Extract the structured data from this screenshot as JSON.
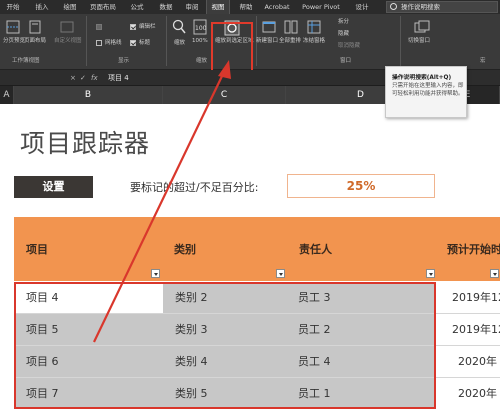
{
  "menu": {
    "tabs": [
      "开始",
      "插入",
      "绘图",
      "页面布局",
      "公式",
      "数据",
      "审阅",
      "视图",
      "帮助",
      "Acrobat",
      "Power Pivot",
      "设计"
    ],
    "active_tab": "视图",
    "search_label": "操作说明搜索"
  },
  "ribbon": {
    "workbook_views": {
      "normal_label": "分页预览",
      "page_layout_label": "页面布局",
      "custom_label": "自定义视图",
      "group_label": "工作簿视图"
    },
    "show": {
      "ruler_label": "编辑栏",
      "gridlines_label": "网格线",
      "headings_label": "标题",
      "group_label": "显示"
    },
    "zoom": {
      "zoom_label": "缩放",
      "hundred_label": "100%",
      "zoom_selection_label": "缩放到选定区域",
      "group_label": "缩放"
    },
    "window": {
      "new_window_label": "新建窗口",
      "arrange_all_label": "全部重排",
      "freeze_label": "冻结窗格",
      "split_label": "拆分",
      "hide_label": "隐藏",
      "unhide_label": "取消隐藏",
      "group_label": "窗口"
    },
    "switch": {
      "switch_windows_label": "切换窗口",
      "group_label": "宏"
    }
  },
  "tooltip": {
    "title": "操作说明搜索(Alt+Q)",
    "body": "只需开始在这里输入内容，即可轻松利用功能并获得帮助。"
  },
  "formula_bar": {
    "name_box": "",
    "cancel": "×",
    "enter": "✓",
    "fx": "fx",
    "content": "项目 4"
  },
  "columns": [
    "A",
    "B",
    "C",
    "D",
    "E"
  ],
  "selected_columns": [
    "B",
    "C",
    "D"
  ],
  "sheet": {
    "title": "项目跟踪器",
    "setup_button": "设置",
    "percent_label": "要标记的超过/不足百分比:",
    "percent_value": "25%"
  },
  "table": {
    "headers": [
      "项目",
      "类别",
      "责任人",
      "预计开始时"
    ],
    "rows": [
      [
        "项目 4",
        "类别 2",
        "员工 3",
        "2019年12"
      ],
      [
        "项目 5",
        "类别 3",
        "员工 2",
        "2019年12"
      ],
      [
        "项目 6",
        "类别 4",
        "员工 4",
        "2020年"
      ],
      [
        "项目 7",
        "类别 5",
        "员工 1",
        "2020年"
      ]
    ]
  },
  "colors": {
    "header_orange": "#f2944f",
    "selection_gray": "#c7c7c7",
    "annotation_red": "#d9372c",
    "ribbon_dark": "#3a3a3a"
  }
}
